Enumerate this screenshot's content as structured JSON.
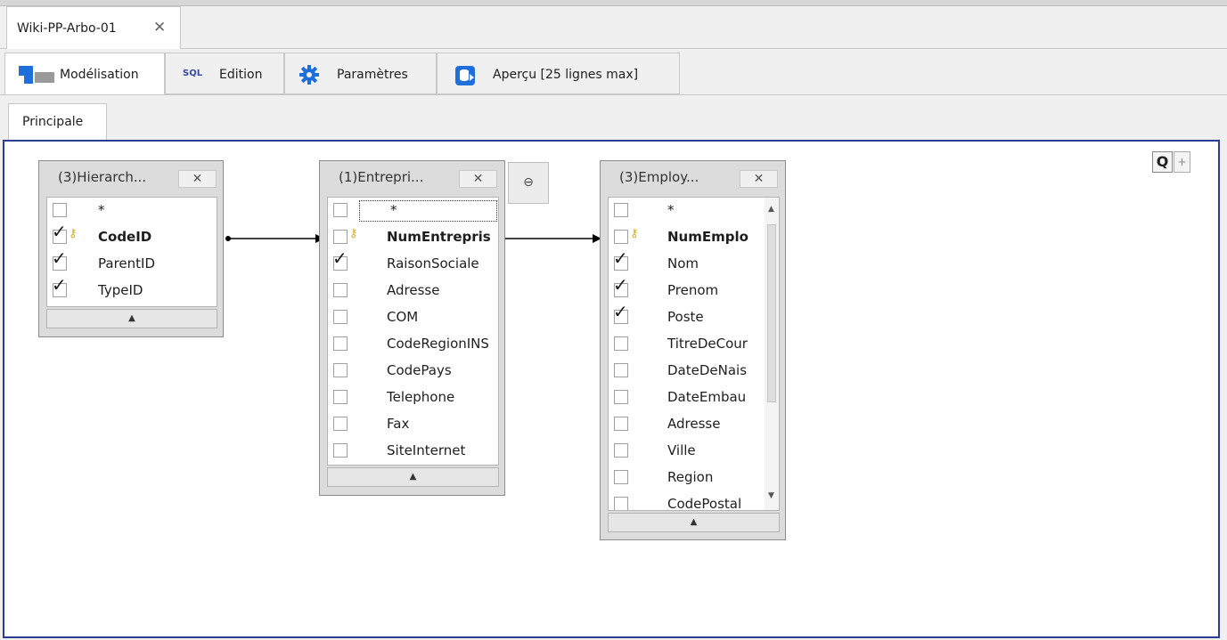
{
  "document_tab": {
    "label": "Wiki-PP-Arbo-01",
    "close": "✕"
  },
  "ribbon_tabs": [
    {
      "label": "Modélisation",
      "icon": "diagram-icon"
    },
    {
      "label": "Edition",
      "icon_text": "SQL"
    },
    {
      "label": "Paramètres",
      "icon": "gear-icon"
    },
    {
      "label": "Aperçu [25 lignes max]",
      "icon": "database-icon"
    }
  ],
  "sub_tab": {
    "label": "Principale"
  },
  "tables": [
    {
      "title": "(3)Hierarch...",
      "close": "✕",
      "fields": [
        {
          "name": "*",
          "checked": false,
          "key": false,
          "bold": false
        },
        {
          "name": "CodeID",
          "checked": true,
          "key": true,
          "bold": true
        },
        {
          "name": "ParentID",
          "checked": true,
          "key": false,
          "bold": false
        },
        {
          "name": "TypeID",
          "checked": true,
          "key": false,
          "bold": false
        }
      ]
    },
    {
      "title": "(1)Entrepri...",
      "close": "✕",
      "fields": [
        {
          "name": "*",
          "checked": false,
          "key": false,
          "bold": false
        },
        {
          "name": "NumEntrepris",
          "checked": false,
          "key": true,
          "bold": true
        },
        {
          "name": "RaisonSociale",
          "checked": true,
          "key": false,
          "bold": false
        },
        {
          "name": "Adresse",
          "checked": false,
          "key": false,
          "bold": false
        },
        {
          "name": "COM",
          "checked": false,
          "key": false,
          "bold": false
        },
        {
          "name": "CodeRegionINS",
          "checked": false,
          "key": false,
          "bold": false
        },
        {
          "name": "CodePays",
          "checked": false,
          "key": false,
          "bold": false
        },
        {
          "name": "Telephone",
          "checked": false,
          "key": false,
          "bold": false
        },
        {
          "name": "Fax",
          "checked": false,
          "key": false,
          "bold": false
        },
        {
          "name": "SiteInternet",
          "checked": false,
          "key": false,
          "bold": false
        }
      ]
    },
    {
      "title": "(3)Employ...",
      "close": "✕",
      "fields": [
        {
          "name": "*",
          "checked": false,
          "key": false,
          "bold": false
        },
        {
          "name": "NumEmplo",
          "checked": false,
          "key": true,
          "bold": true
        },
        {
          "name": "Nom",
          "checked": true,
          "key": false,
          "bold": false
        },
        {
          "name": "Prenom",
          "checked": true,
          "key": false,
          "bold": false
        },
        {
          "name": "Poste",
          "checked": true,
          "key": false,
          "bold": false
        },
        {
          "name": "TitreDeCour",
          "checked": false,
          "key": false,
          "bold": false
        },
        {
          "name": "DateDeNais",
          "checked": false,
          "key": false,
          "bold": false
        },
        {
          "name": "DateEmbau",
          "checked": false,
          "key": false,
          "bold": false
        },
        {
          "name": "Adresse",
          "checked": false,
          "key": false,
          "bold": false
        },
        {
          "name": "Ville",
          "checked": false,
          "key": false,
          "bold": false
        },
        {
          "name": "Region",
          "checked": false,
          "key": false,
          "bold": false
        },
        {
          "name": "CodePostal",
          "checked": false,
          "key": false,
          "bold": false
        }
      ]
    }
  ],
  "zoom_controls": {
    "q": "Q",
    "plus": "+"
  },
  "colors": {
    "canvas_border": "#2c3c8f",
    "key_icon": "#d7a91d",
    "accent_blue": "#1e6fd9"
  }
}
